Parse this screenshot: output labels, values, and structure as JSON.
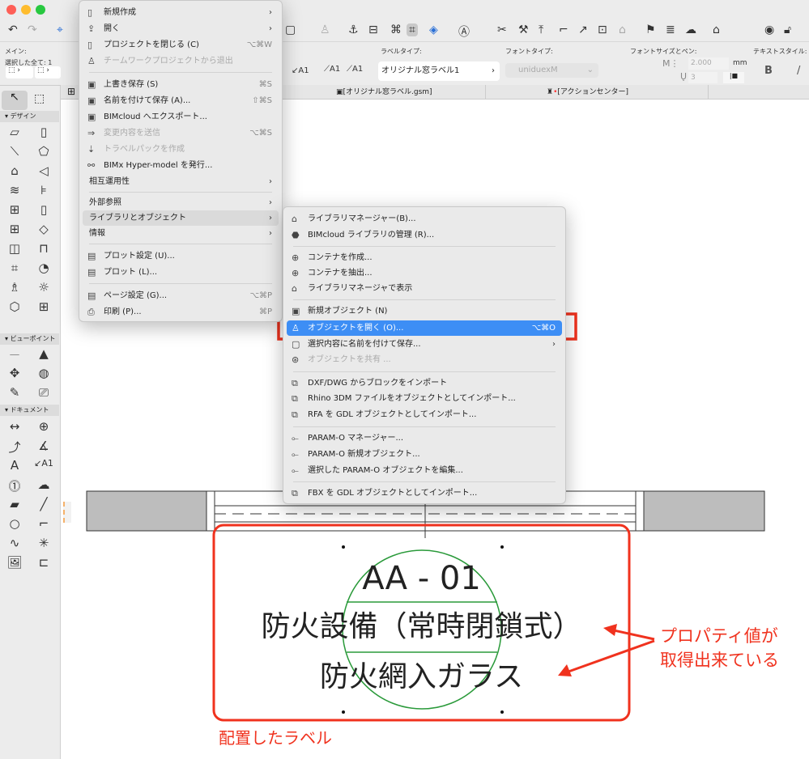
{
  "window": {
    "traffic": [
      "#fe5f57",
      "#febc2e",
      "#28c840"
    ]
  },
  "infobox": {
    "main_label": "メイン:",
    "selection_label": "選択した全て: 1",
    "label_type_label": "ラベルタイプ:",
    "label_type_value": "オリジナル窓ラベル1",
    "font_type_label": "フォントタイプ:",
    "font_type_value": "uniduexM",
    "font_size_label": "フォントサイズとペン:",
    "font_size_value": "2.000",
    "font_size_unit": "mm",
    "pen_value": "3",
    "text_style_label": "テキストスタイル:",
    "bold": "B",
    "italic": "/"
  },
  "tabs": [
    {
      "label": "[オリジナル窓ラベル.gsm]"
    },
    {
      "label": "[アクションセンター]"
    }
  ],
  "toolbox": {
    "sections": [
      "デザイン",
      "ビューポイント",
      "ドキュメント"
    ]
  },
  "file_menu": {
    "items": [
      {
        "label": "新規作成",
        "icon": "document-icon",
        "arrow": "›"
      },
      {
        "label": "開く",
        "icon": "open-icon",
        "arrow": "›"
      },
      {
        "label": "プロジェクトを閉じる (C)",
        "icon": "close-project-icon",
        "shortcut": "⌥⌘W"
      },
      {
        "label": "チームワークプロジェクトから退出",
        "icon": "leave-team-icon",
        "disabled": true
      },
      {
        "label": "上書き保存 (S)",
        "icon": "save-icon",
        "shortcut": "⌘S"
      },
      {
        "label": "名前を付けて保存 (A)...",
        "icon": "save-as-icon",
        "shortcut": "⇧⌘S"
      },
      {
        "label": "BIMcloud へエクスポート...",
        "icon": "bimcloud-export-icon"
      },
      {
        "label": "変更内容を送信",
        "icon": "send-icon",
        "shortcut": "⌥⌘S",
        "disabled": true
      },
      {
        "label": "トラベルパックを作成",
        "icon": "travelpack-icon",
        "disabled": true
      },
      {
        "label": "BIMx Hyper-model を発行...",
        "icon": "bimx-icon"
      },
      {
        "label": "相互運用性",
        "arrow": "›"
      },
      {
        "label": "外部参照",
        "arrow": "›"
      },
      {
        "label": "ライブラリとオブジェクト",
        "arrow": "›"
      },
      {
        "label": "情報",
        "arrow": "›"
      },
      {
        "label": "プロット設定 (U)...",
        "icon": "plot-setup-icon"
      },
      {
        "label": "プロット (L)...",
        "icon": "plot-icon"
      },
      {
        "label": "ページ設定 (G)...",
        "icon": "page-setup-icon",
        "shortcut": "⌥⌘P"
      },
      {
        "label": "印刷 (P)...",
        "icon": "print-icon",
        "shortcut": "⌘P"
      }
    ]
  },
  "sub_menu": {
    "items": [
      {
        "label": "ライブラリマネージャー(B)..."
      },
      {
        "label": "BIMcloud ライブラリの管理 (R)..."
      },
      {
        "label": "コンテナを作成..."
      },
      {
        "label": "コンテナを抽出..."
      },
      {
        "label": "ライブラリマネージャで表示"
      },
      {
        "label": "新規オブジェクト (N)"
      },
      {
        "label": "オブジェクトを開く (O)...",
        "shortcut": "⌥⌘O"
      },
      {
        "label": "選択内容に名前を付けて保存...",
        "arrow": "›"
      },
      {
        "label": "オブジェクトを共有 ..."
      },
      {
        "label": "DXF/DWG からブロックをインポート"
      },
      {
        "label": "Rhino 3DM ファイルをオブジェクトとしてインポート..."
      },
      {
        "label": "RFA を GDL オブジェクトとしてインポート..."
      },
      {
        "label": "PARAM-O マネージャー..."
      },
      {
        "label": "PARAM-O 新規オブジェクト..."
      },
      {
        "label": "選択した PARAM-O オブジェクトを編集..."
      },
      {
        "label": "FBX を GDL オブジェクトとしてインポート..."
      }
    ]
  },
  "drawing": {
    "label_id": "AA - 01",
    "label_line2": "防火設備（常時閉鎖式）",
    "label_line3": "防火網入ガラス"
  },
  "annotations": {
    "property_note_1": "プロパティ値が",
    "property_note_2": "取得出来ている",
    "placed_label": "配置したラベル",
    "accent": "#f0321e"
  }
}
